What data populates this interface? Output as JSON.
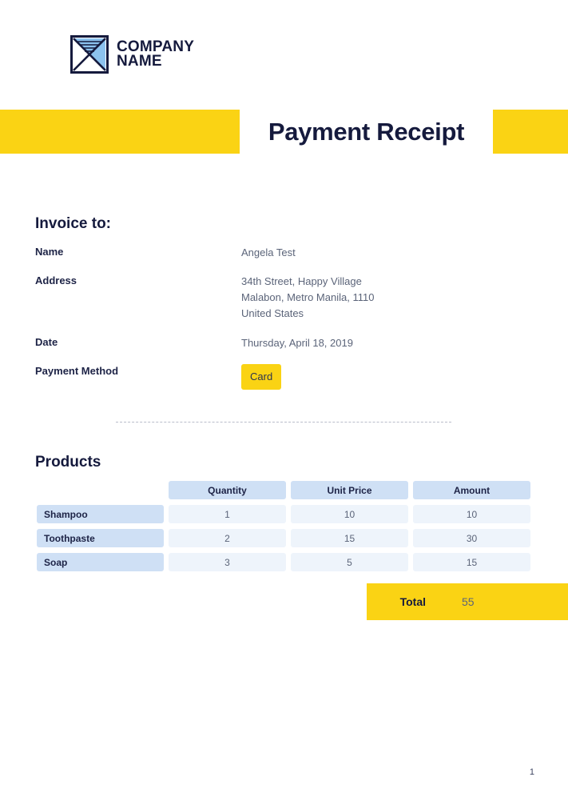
{
  "logo": {
    "icon": "envelope-logo-mark",
    "line1": "COMPANY",
    "line2": "NAME"
  },
  "header": {
    "title": "Payment Receipt",
    "accent_color": "#fad314",
    "title_color": "#151a3d"
  },
  "invoice": {
    "heading": "Invoice to:",
    "rows": [
      {
        "label": "Name",
        "value": "Angela Test"
      },
      {
        "label": "Address",
        "value": "34th Street, Happy Village\nMalabon, Metro Manila, 1110\nUnited States"
      },
      {
        "label": "Date",
        "value": "Thursday, April 18, 2019"
      },
      {
        "label": "Payment Method",
        "value": "Card"
      }
    ]
  },
  "products": {
    "heading": "Products",
    "columns": [
      "",
      "Quantity",
      "Unit Price",
      "Amount"
    ],
    "rows": [
      {
        "name": "Shampoo",
        "quantity": "1",
        "unit_price": "10",
        "amount": "10"
      },
      {
        "name": "Toothpaste",
        "quantity": "2",
        "unit_price": "15",
        "amount": "30"
      },
      {
        "name": "Soap",
        "quantity": "3",
        "unit_price": "5",
        "amount": "15"
      }
    ]
  },
  "total": {
    "label": "Total",
    "value": "55"
  },
  "footer": {
    "page_number": "1"
  }
}
